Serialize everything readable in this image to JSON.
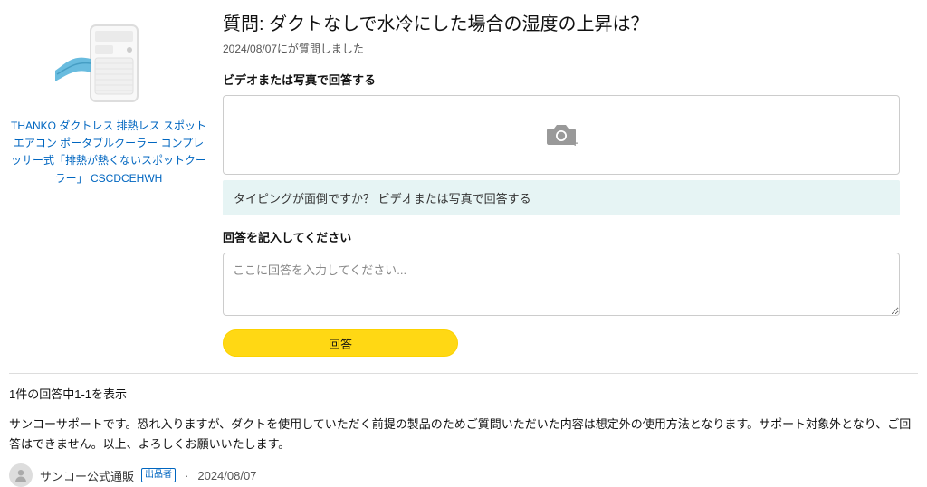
{
  "product": {
    "title": "THANKO ダクトレス 排熱レス スポットエアコン ポータブルクーラー コンプレッサー式「排熱が熱くないスポットクーラー」 CSCDCEHWH"
  },
  "question": {
    "title": "質問: ダクトなしで水冷にした場合の湿度の上昇は？",
    "meta": "2024/08/07にが質問しました"
  },
  "form": {
    "media_label": "ビデオまたは写真で回答する",
    "hint": "タイピングが面倒ですか？ ビデオまたは写真で回答する",
    "answer_label": "回答を記入してください",
    "placeholder": "ここに回答を入力してください...",
    "submit": "回答"
  },
  "answers": {
    "count_line": "1件の回答中1-1を表示",
    "items": [
      {
        "body": "サンコーサポートです。恐れ入りますが、ダクトを使用していただく前提の製品のためご質問いただいた内容は想定外の使用方法となります。サポート対象外となり、ご回答はできません。以上、よろしくお願いいたします。",
        "author": "サンコー公式通販",
        "badge": "出品者",
        "date": "2024/08/07"
      }
    ]
  }
}
